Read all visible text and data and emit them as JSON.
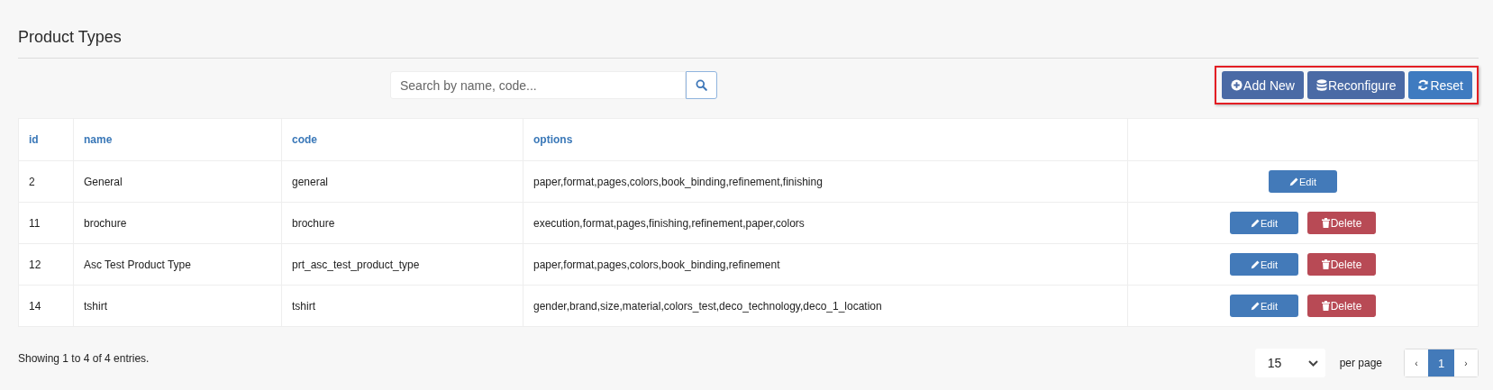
{
  "title": "Product Types",
  "search": {
    "placeholder": "Search by name, code..."
  },
  "toolbar": {
    "highlighted": true,
    "buttons": [
      {
        "kind": "add",
        "label": "Add New"
      },
      {
        "kind": "database",
        "label": "Reconfigure"
      },
      {
        "kind": "reset",
        "label": "Reset"
      }
    ]
  },
  "table": {
    "columns": [
      "id",
      "name",
      "code",
      "options"
    ],
    "rows": [
      {
        "cells": [
          "2",
          "General",
          "general",
          "paper,format,pages,colors,book_binding,refinement,finishing"
        ],
        "actions": [
          {
            "kind": "edit",
            "label": "Edit"
          }
        ]
      },
      {
        "cells": [
          "11",
          "brochure",
          "brochure",
          "execution,format,pages,finishing,refinement,paper,colors"
        ],
        "actions": [
          {
            "kind": "edit",
            "label": "Edit"
          },
          {
            "kind": "delete",
            "label": "Delete"
          }
        ]
      },
      {
        "cells": [
          "12",
          "Asc Test Product Type",
          "prt_asc_test_product_type",
          "paper,format,pages,colors,book_binding,refinement"
        ],
        "actions": [
          {
            "kind": "edit",
            "label": "Edit"
          },
          {
            "kind": "delete",
            "label": "Delete"
          }
        ]
      },
      {
        "cells": [
          "14",
          "tshirt",
          "tshirt",
          "gender,brand,size,material,colors_test,deco_technology,deco_1_location"
        ],
        "actions": [
          {
            "kind": "edit",
            "label": "Edit"
          },
          {
            "kind": "delete",
            "label": "Delete"
          }
        ]
      }
    ]
  },
  "footer": {
    "summary": "Showing 1 to 4 of 4 entries.",
    "per_page": "15",
    "per_page_label": "per page",
    "pages": [
      {
        "label": "‹",
        "selected": false
      },
      {
        "label": "1",
        "selected": true
      },
      {
        "label": "›",
        "selected": false
      }
    ]
  }
}
